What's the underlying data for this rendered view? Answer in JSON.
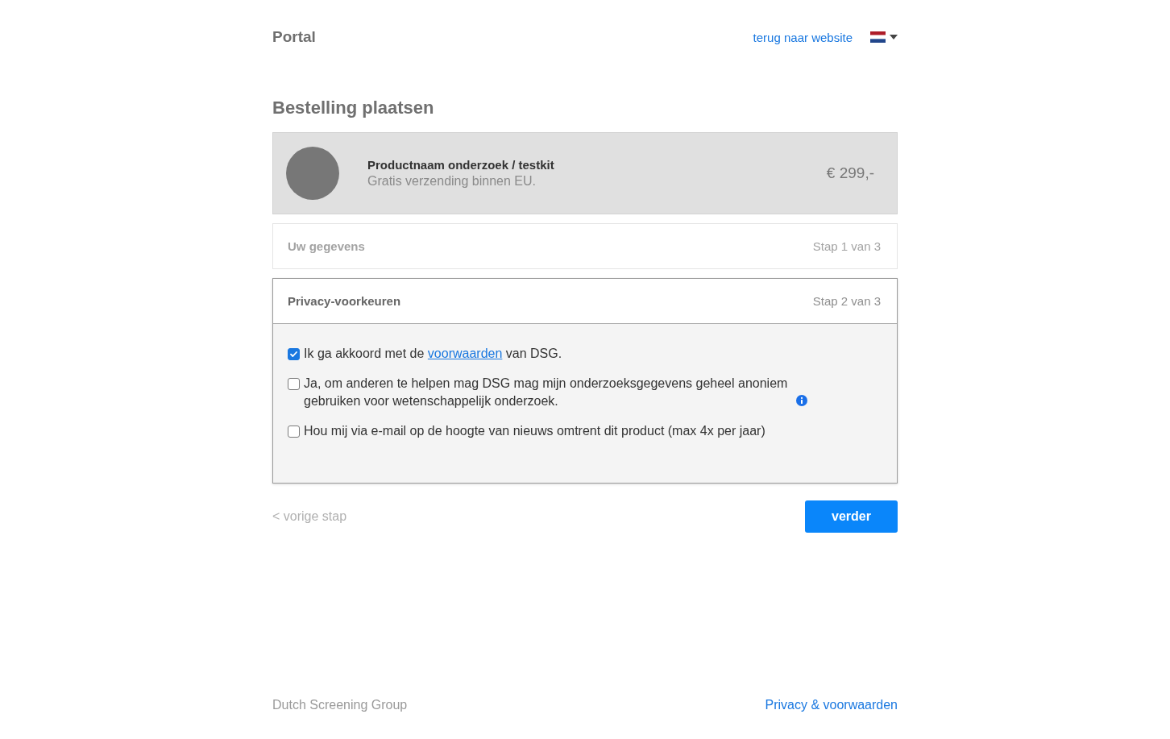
{
  "header": {
    "title": "Portal",
    "back_link": "terug naar website"
  },
  "page_title": "Bestelling plaatsen",
  "product": {
    "name": "Productnaam onderzoek / testkit",
    "note": "Gratis verzending binnen EU.",
    "price": "€ 299,-"
  },
  "steps": [
    {
      "title": "Uw gegevens",
      "progress": "Stap 1 van 3",
      "selected": false
    },
    {
      "title": "Privacy-voorkeuren",
      "progress": "Stap 2 van 3",
      "selected": true,
      "options": [
        {
          "checked": true,
          "info": false,
          "parts": [
            {
              "kind": "text",
              "text": "Ik ga akkoord met de "
            },
            {
              "kind": "link",
              "text": "voorwaarden"
            },
            {
              "kind": "text",
              "text": " van DSG."
            }
          ]
        },
        {
          "checked": false,
          "info": true,
          "parts": [
            {
              "kind": "text",
              "text": "Ja, om anderen te helpen mag DSG mag mijn onderzoeksgegevens geheel anoniem gebruiken voor wetenschappelijk onderzoek."
            }
          ]
        },
        {
          "checked": false,
          "info": false,
          "parts": [
            {
              "kind": "text",
              "text": "Hou mij via e-mail op de hoogte van nieuws omtrent dit product (max 4x per jaar)"
            }
          ]
        }
      ]
    }
  ],
  "nav": {
    "back": {
      "label": "< vorige stap",
      "disabled": true
    },
    "next": "verder"
  },
  "footer": {
    "company": "Dutch Screening Group",
    "link": "Privacy & voorwaarden"
  }
}
